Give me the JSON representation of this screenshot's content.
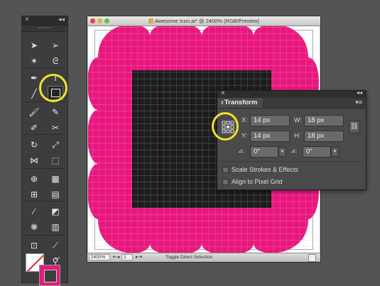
{
  "document": {
    "title": "Awesome Icon.ai* @ 2400% (RGB/Preview)",
    "zoom": "2400%",
    "page_number": "1",
    "status_text": "Toggle Direct Selection"
  },
  "colors": {
    "artwork_pink": "#e8177d",
    "artwork_black": "#1c1c1c",
    "highlight": "#f2e22a"
  },
  "tools_panel": {
    "tools": [
      {
        "name": "selection-tool-icon",
        "row": 0,
        "side": "l"
      },
      {
        "name": "direct-selection-tool-icon",
        "row": 0,
        "side": "r"
      },
      {
        "name": "magic-wand-tool-icon",
        "row": 1,
        "side": "l"
      },
      {
        "name": "lasso-tool-icon",
        "row": 1,
        "side": "r"
      },
      {
        "name": "pen-tool-icon",
        "row": 2,
        "side": "l"
      },
      {
        "name": "type-tool-icon",
        "row": 2,
        "side": "r"
      },
      {
        "name": "line-segment-tool-icon",
        "row": 3,
        "side": "l"
      },
      {
        "name": "rectangle-tool-icon",
        "row": 3,
        "side": "r"
      },
      {
        "name": "paintbrush-tool-icon",
        "row": 4,
        "side": "l"
      },
      {
        "name": "pencil-tool-icon",
        "row": 4,
        "side": "r"
      },
      {
        "name": "blob-brush-tool-icon",
        "row": 5,
        "side": "l"
      },
      {
        "name": "scissors-tool-icon",
        "row": 5,
        "side": "r"
      },
      {
        "name": "rotate-tool-icon",
        "row": 6,
        "side": "l"
      },
      {
        "name": "scale-tool-icon",
        "row": 6,
        "side": "r"
      },
      {
        "name": "width-tool-icon",
        "row": 7,
        "side": "l"
      },
      {
        "name": "free-transform-tool-icon",
        "row": 7,
        "side": "r"
      },
      {
        "name": "shape-builder-tool-icon",
        "row": 8,
        "side": "l"
      },
      {
        "name": "perspective-grid-tool-icon",
        "row": 8,
        "side": "r"
      },
      {
        "name": "mesh-tool-icon",
        "row": 9,
        "side": "l"
      },
      {
        "name": "gradient-tool-icon",
        "row": 9,
        "side": "r"
      },
      {
        "name": "eyedropper-tool-icon",
        "row": 10,
        "side": "l"
      },
      {
        "name": "blend-tool-icon",
        "row": 10,
        "side": "r"
      },
      {
        "name": "symbol-sprayer-tool-icon",
        "row": 11,
        "side": "l"
      },
      {
        "name": "column-graph-tool-icon",
        "row": 11,
        "side": "r"
      },
      {
        "name": "artboard-tool-icon",
        "row": 12,
        "side": "l"
      },
      {
        "name": "slice-tool-icon",
        "row": 12,
        "side": "r"
      },
      {
        "name": "hand-tool-icon",
        "row": 13,
        "side": "l"
      },
      {
        "name": "zoom-tool-icon",
        "row": 13,
        "side": "r"
      }
    ]
  },
  "transform_panel": {
    "title": "Transform",
    "x_label": "X:",
    "x_value": "14 px",
    "y_label": "Y:",
    "y_value": "14 px",
    "w_label": "W:",
    "w_value": "18 px",
    "h_label": "H:",
    "h_value": "18 px",
    "rotate_value": "0°",
    "shear_value": "0°",
    "scale_strokes_label": "Scale Strokes & Effects",
    "scale_strokes_checked": false,
    "align_pixel_grid_label": "Align to Pixel Grid",
    "align_pixel_grid_checked": false
  }
}
